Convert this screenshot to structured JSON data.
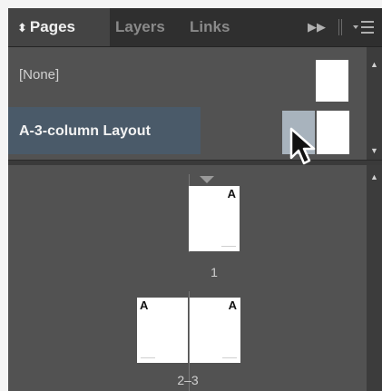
{
  "panel": {
    "tabs": [
      {
        "label": "Pages",
        "icon": "up-down-arrows-icon",
        "active": true
      },
      {
        "label": "Layers",
        "active": false
      },
      {
        "label": "Links",
        "active": false
      }
    ],
    "overflow_icon": "double-chevron-right-icon",
    "menu_icon": "panel-menu-icon"
  },
  "masters": [
    {
      "label": "[None]",
      "selected": false
    },
    {
      "label": "A-3-column Layout",
      "selected": true
    }
  ],
  "pages": {
    "single": {
      "prefix": "A",
      "number": "1"
    },
    "spread": {
      "left_prefix": "A",
      "right_prefix": "A",
      "number": "2–3"
    }
  },
  "colors": {
    "panel_bg": "#525252",
    "tab_bar_bg": "#2f2f2f",
    "active_tab_bg": "#444444",
    "master_highlight": "#4a5a69",
    "selected_thumb": "#a8b3bd",
    "page_white": "#ffffff"
  }
}
